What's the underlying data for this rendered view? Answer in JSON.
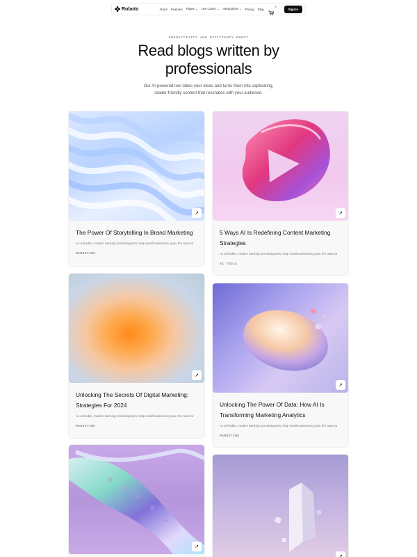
{
  "nav": {
    "brand": "Roboto",
    "items": [
      "About",
      "Features",
      "Pages",
      "Use Cases",
      "Integrations",
      "Pricing",
      "Blog"
    ],
    "cart_count": "0",
    "signin_label": "Sign In"
  },
  "hero": {
    "eyebrow": "PRODUCTIVITY AND EFFICIENCY BOOST",
    "title": "Read blogs written by professionals",
    "subtitle": "Our AI-powered tool takes your ideas and turns them into captivating, reader-friendly content that resonates with your audience."
  },
  "posts": [
    {
      "title": "The Power Of Storytelling In Brand Marketing",
      "excerpt": "As a flexible, modern banking tool designed to help small businesses grow, the team at",
      "tag": "MARKETING",
      "image": "blue-waves"
    },
    {
      "title": "5 Ways AI Is Redefining Content Marketing Strategies",
      "excerpt": "As a flexible, modern banking tool designed to help small businesses grow, the team at",
      "tag": "AI TOOLS",
      "image": "pink-glass-ring"
    },
    {
      "title": "Unlocking The Secrets Of Digital Marketing: Strategies For 2024",
      "excerpt": "As a flexible, modern banking tool designed to help small businesses grow, the team at",
      "tag": "MARKETING",
      "image": "orange-gradient-orb"
    },
    {
      "title": "Unlocking The Power Of Data: How AI Is Transforming Marketing Analytics",
      "excerpt": "As a flexible, modern banking tool designed to help small businesses grow, the team at",
      "tag": "MARKETING",
      "image": "iridescent-egg"
    },
    {
      "title": "",
      "excerpt": "",
      "tag": "",
      "image": "holographic-twist"
    },
    {
      "title": "",
      "excerpt": "",
      "tag": "",
      "image": "lilac-shapes"
    }
  ],
  "colors": {
    "accent": "#111111",
    "background": "#ffffff",
    "card": "#f8f8f8"
  }
}
